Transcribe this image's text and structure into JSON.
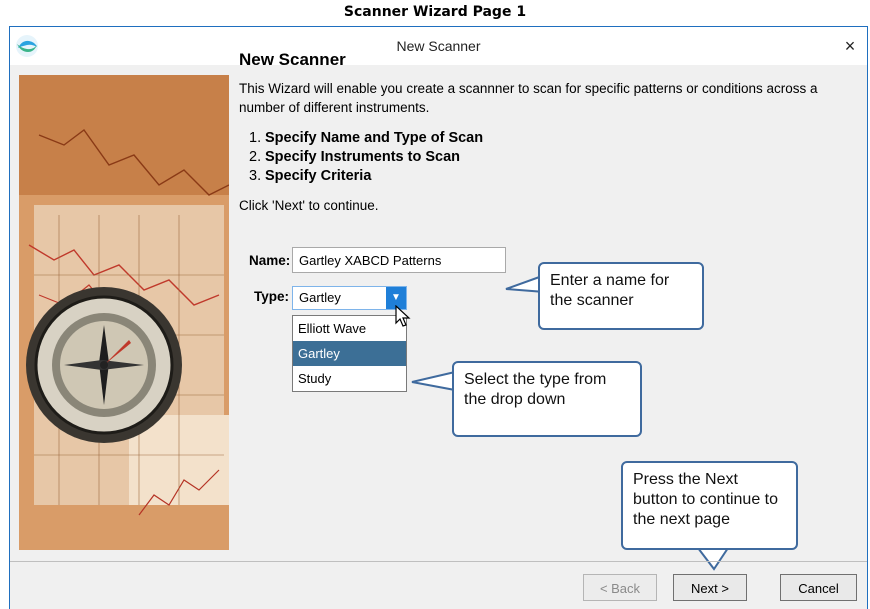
{
  "page_caption": "Scanner Wizard Page 1",
  "window": {
    "title": "New Scanner",
    "close_glyph": "×"
  },
  "content": {
    "heading": "New Scanner",
    "intro": "This Wizard will enable you create a scannner to scan for specific patterns or conditions across a number of different instruments.",
    "steps": [
      {
        "num": "1.",
        "label": "Specify Name and Type of Scan"
      },
      {
        "num": "2.",
        "label": "Specify Instruments to Scan"
      },
      {
        "num": "3.",
        "label": "Specify Criteria"
      }
    ],
    "continue_text": "Click 'Next' to continue."
  },
  "form": {
    "name_label": "Name:",
    "name_value": "Gartley XABCD Patterns",
    "type_label": "Type:",
    "type_value": "Gartley",
    "type_options": [
      "Elliott Wave",
      "Gartley",
      "Study"
    ],
    "selected_option_index": 1
  },
  "callouts": {
    "name": "Enter a name for the scanner",
    "type": "Select the type from the drop down",
    "next": "Press the Next button to continue to the next page"
  },
  "buttons": {
    "back": "< Back",
    "next": "Next >",
    "cancel": "Cancel"
  },
  "colors": {
    "accent": "#1f7fd8",
    "selected": "#3c6f96",
    "callout_border": "#3f6a9e"
  },
  "icons": {
    "app": "scanner-app-icon",
    "close": "close-icon",
    "arrow": "dropdown-arrow-icon",
    "cursor": "mouse-pointer-icon"
  }
}
